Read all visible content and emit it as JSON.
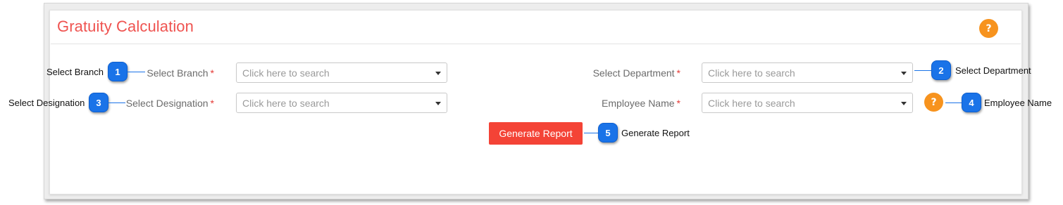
{
  "panel": {
    "title": "Gratuity Calculation"
  },
  "fields": {
    "branch": {
      "label": "Select Branch",
      "required_mark": "*",
      "placeholder": "Click here to search"
    },
    "department": {
      "label": "Select Department",
      "required_mark": "*",
      "placeholder": "Click here to search"
    },
    "designation": {
      "label": "Select Designation",
      "required_mark": "*",
      "placeholder": "Click here to search"
    },
    "employee": {
      "label": "Employee Name",
      "required_mark": "*",
      "placeholder": "Click here to search"
    }
  },
  "help_icon": "?",
  "actions": {
    "generate_label": "Generate Report"
  },
  "callouts": [
    {
      "number": "1",
      "text": "Select Branch"
    },
    {
      "number": "2",
      "text": "Select Department"
    },
    {
      "number": "3",
      "text": "Select Designation"
    },
    {
      "number": "4",
      "text": "Employee Name"
    },
    {
      "number": "5",
      "text": "Generate Report"
    }
  ],
  "colors": {
    "title": "#ef5350",
    "help": "#f7931e",
    "button": "#f44336",
    "callout": "#1a73e8"
  }
}
